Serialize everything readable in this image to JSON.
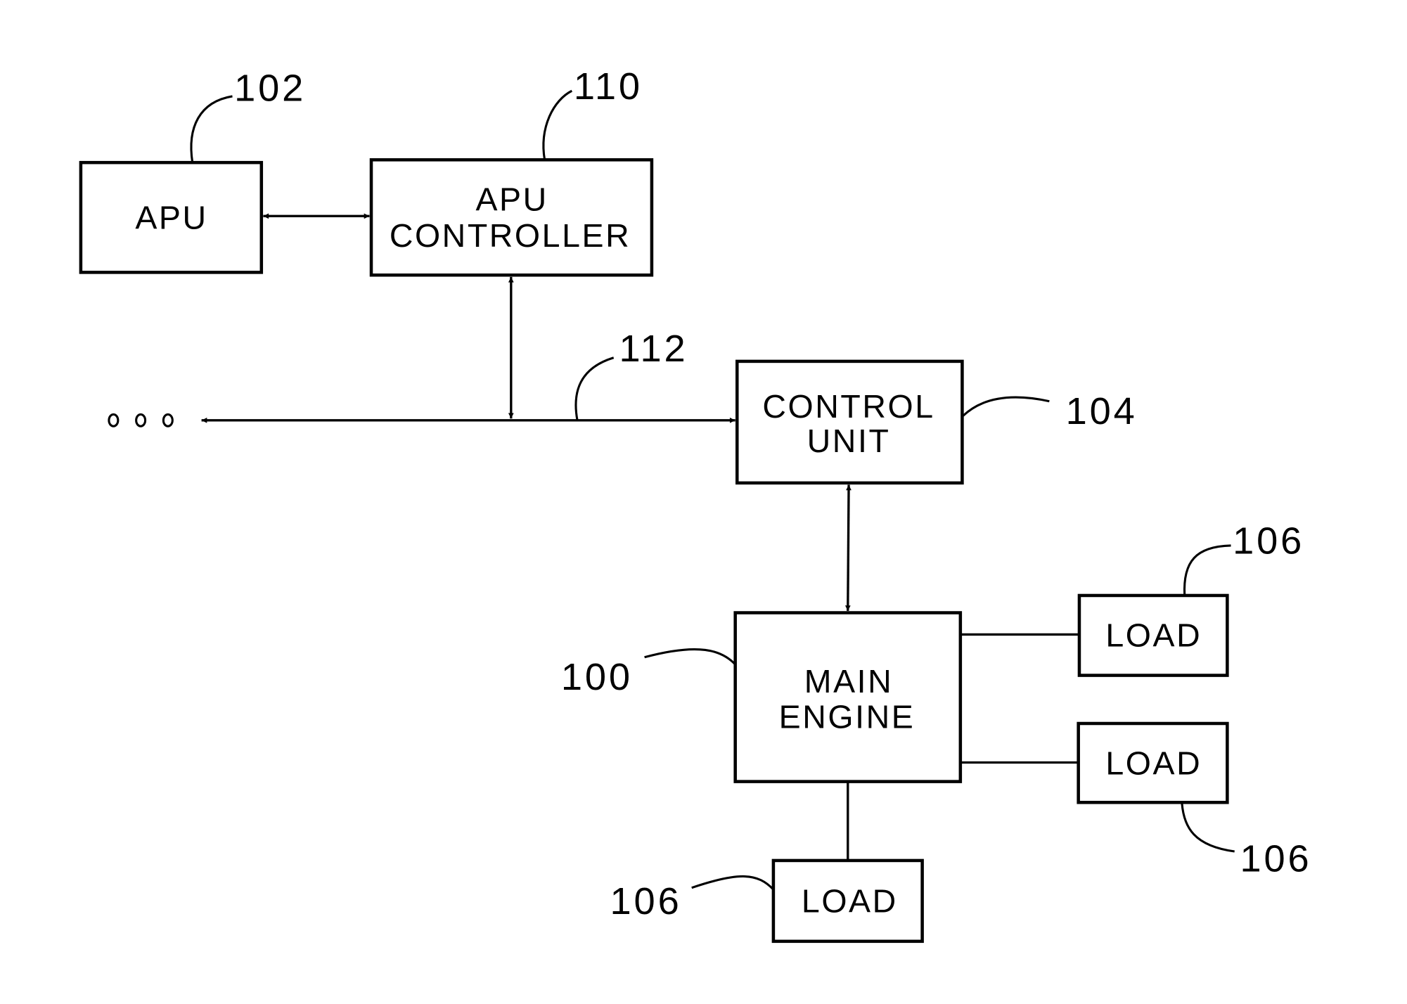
{
  "diagram": {
    "type": "block-diagram",
    "blocks": {
      "apu": {
        "lines": [
          "APU"
        ],
        "ref": "102"
      },
      "apu_controller": {
        "lines": [
          "APU",
          "CONTROLLER"
        ],
        "ref": "110"
      },
      "control_unit": {
        "lines": [
          "CONTROL",
          "UNIT"
        ],
        "ref": "104"
      },
      "main_engine": {
        "lines": [
          "MAIN",
          "ENGINE"
        ],
        "ref": "100"
      },
      "load_1": {
        "lines": [
          "LOAD"
        ],
        "ref": "106"
      },
      "load_2": {
        "lines": [
          "LOAD"
        ],
        "ref": "106"
      },
      "load_3": {
        "lines": [
          "LOAD"
        ],
        "ref": "106"
      }
    },
    "bus": {
      "ref": "112",
      "continuation": "o o o"
    },
    "connections": [
      {
        "from": "apu",
        "to": "apu_controller",
        "kind": "bidirectional"
      },
      {
        "from": "apu_controller",
        "to": "bus",
        "kind": "bidirectional"
      },
      {
        "from": "bus",
        "to": "control_unit",
        "kind": "directed"
      },
      {
        "from": "bus",
        "to": "continuation",
        "kind": "directed"
      },
      {
        "from": "control_unit",
        "to": "main_engine",
        "kind": "bidirectional"
      },
      {
        "from": "main_engine",
        "to": "load_1",
        "kind": "line"
      },
      {
        "from": "main_engine",
        "to": "load_2",
        "kind": "line"
      },
      {
        "from": "main_engine",
        "to": "load_3",
        "kind": "line"
      }
    ]
  }
}
